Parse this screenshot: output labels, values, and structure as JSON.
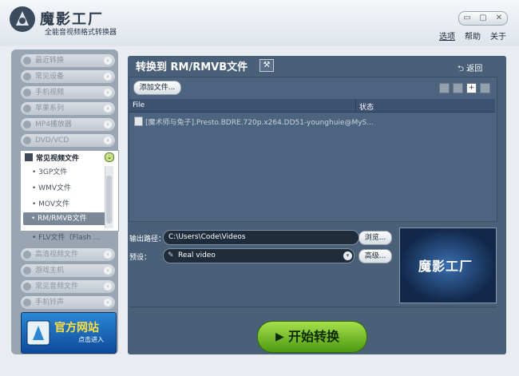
{
  "app": {
    "title": "魔影工厂",
    "subtitle": "全能音视频格式转换器",
    "controls": [
      "▭",
      "▢",
      "✕"
    ]
  },
  "menu": {
    "options": "选项",
    "help": "帮助",
    "about": "关于"
  },
  "sidebar": {
    "items_top": [
      {
        "label": "最近转换",
        "icon": "clock-icon"
      },
      {
        "label": "常见设备",
        "icon": "device-icon"
      },
      {
        "label": "手机视频",
        "icon": "phone-icon"
      },
      {
        "label": "苹果系列",
        "icon": "apple-icon"
      },
      {
        "label": "MP4播放器",
        "icon": "mp4-player-icon"
      },
      {
        "label": "DVD/VCD",
        "icon": "disc-icon"
      }
    ],
    "expanded": {
      "label": "常见视频文件",
      "items": [
        "3GP文件",
        "WMV文件",
        "MOV文件",
        "RM/RMVB文件",
        "FLV文件（Flash ..."
      ],
      "selected_index": 3
    },
    "items_bottom": [
      {
        "label": "高清视频文件",
        "icon": "hd-icon"
      },
      {
        "label": "游戏主机",
        "icon": "gamepad-icon"
      },
      {
        "label": "常见音频文件",
        "icon": "music-icon"
      },
      {
        "label": "手机铃声",
        "icon": "ringtone-icon"
      }
    ],
    "banner": {
      "title": "官方网站",
      "subtitle": "点击进入"
    }
  },
  "main": {
    "title": "转换到 RM/RMVB文件",
    "back": "返回",
    "add_file": "添加文件...",
    "columns": {
      "file": "File",
      "state": "状态"
    },
    "files": [
      {
        "name": "[魔术师与兔子].Presto.BDRE.720p.x264.DD51-younghuie@MyS..."
      }
    ],
    "output_label": "输出路径：",
    "output_path": "C:\\Users\\Code\\Videos",
    "browse": "浏览...",
    "preset_label": "预设：",
    "preset_value": "Real video",
    "advanced": "高级...",
    "preview_text": "魔影工厂",
    "start": "开始转换"
  }
}
